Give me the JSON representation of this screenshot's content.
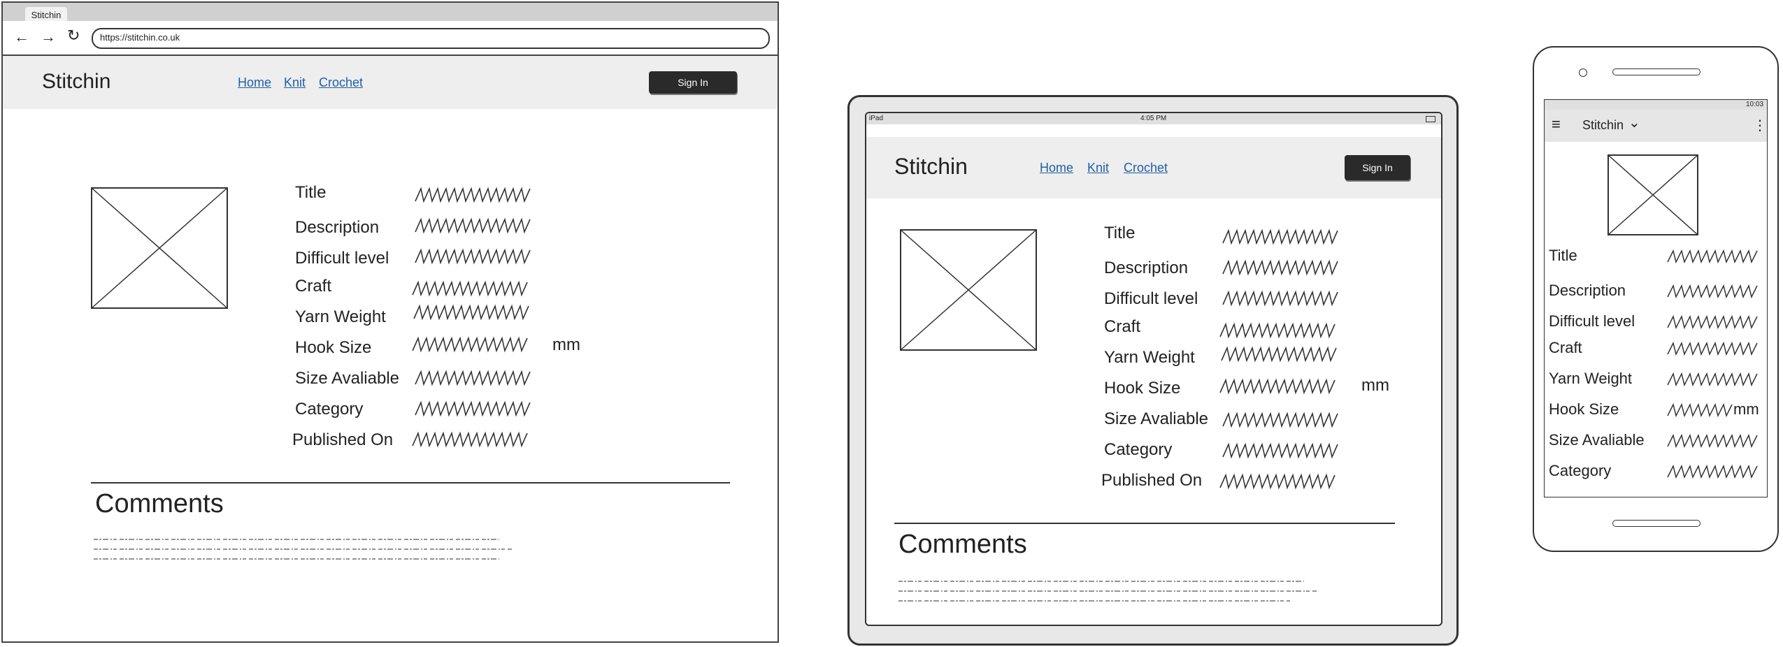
{
  "browser": {
    "tab_title": "Stitchin",
    "url": "https://stitchin.co.uk",
    "back_icon": "←",
    "forward_icon": "→",
    "reload_icon": "↻"
  },
  "site": {
    "brand": "Stitchin",
    "nav": [
      "Home",
      "Knit",
      "Crochet"
    ],
    "sign_in": "Sign In"
  },
  "fields": [
    "Title",
    "Description",
    "Difficult level",
    "Craft",
    "Yarn Weight",
    "Hook Size",
    "Size Avaliable",
    "Category",
    "Published On"
  ],
  "hook_unit": "mm",
  "comments": {
    "heading": "Comments"
  },
  "tablet": {
    "status_left": "iPad",
    "status_time": "4:05 PM"
  },
  "phone": {
    "menu_icon": "≡",
    "brand": "Stitchin",
    "dropdown_icon": "⌄",
    "more_icon": "⋮",
    "status_time": "10:03"
  }
}
